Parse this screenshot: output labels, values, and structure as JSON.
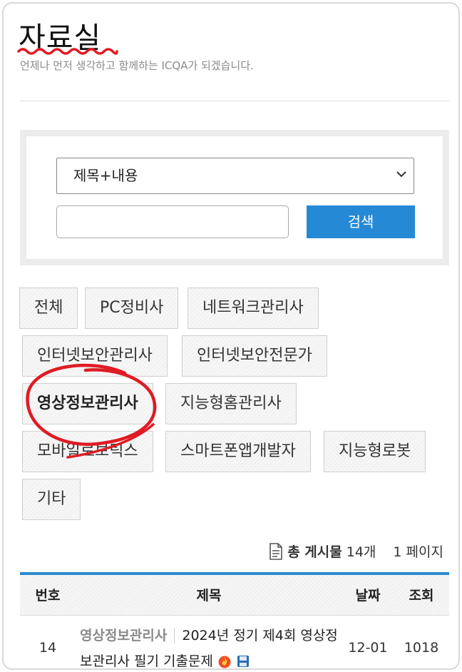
{
  "page": {
    "title": "자료실",
    "subtitle": "언제나 먼저 생각하고 함께하는 ICQA가 되겠습니다."
  },
  "search": {
    "select_value": "제목+내용",
    "input_placeholder": "",
    "button_label": "검색"
  },
  "categories": [
    "전체",
    "PC정비사",
    "네트워크관리사",
    "인터넷보안관리사",
    "인터넷보안전문가",
    "영상정보관리사",
    "지능형홈관리사",
    "모바일로보틱스",
    "스마트폰앱개발자",
    "지능형로봇",
    "기타"
  ],
  "active_category": "영상정보관리사",
  "board_info": {
    "total_label": "총 게시물",
    "total_count": "14개",
    "page_label": "1 페이지"
  },
  "table": {
    "headers": [
      "번호",
      "제목",
      "날짜",
      "조회"
    ],
    "rows": [
      {
        "num": "14",
        "category": "영상정보관리사",
        "title": "2024년 정기 제4회 영상정보관리사 필기 기출문제",
        "date": "12-01",
        "views": "1018"
      }
    ]
  },
  "colors": {
    "accent": "#2589d5",
    "annotation": "#e01b24"
  }
}
